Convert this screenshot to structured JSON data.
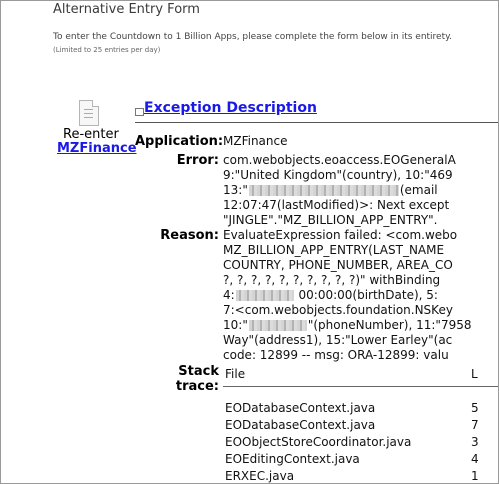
{
  "form": {
    "title": "Alternative Entry Form",
    "instructions": "To enter the Countdown to 1 Billion Apps, please complete the form below in its entirety.",
    "limit_note": "(Limited to 25 entries per day)"
  },
  "reenter": {
    "label": "Re-enter",
    "link": "MZFinance",
    "icon": "document-icon"
  },
  "exception": {
    "title": "Exception Description",
    "application_label": "Application:",
    "application_value": "MZFinance",
    "error_label": "Error:",
    "error_lines": [
      "com.webobjects.eoaccess.EOGeneralA",
      "9:\"United Kingdom\"(country), 10:\"469",
      "13:\"",
      "(email",
      "12:07:47(lastModified)>: Next except",
      "\"JINGLE\".\"MZ_BILLION_APP_ENTRY\"."
    ],
    "reason_label": "Reason:",
    "reason_lines": [
      "EvaluateExpression failed: <com.webo",
      "MZ_BILLION_APP_ENTRY(LAST_NAME",
      "COUNTRY, PHONE_NUMBER, AREA_CO",
      "?, ?, ?, ?, ?, ?, ?, ?, ?, ?)\" withBinding",
      "4:",
      " 00:00:00(birthDate), 5:",
      "7:<com.webobjects.foundation.NSKey",
      "10:\"",
      "\"(phoneNumber), 11:\"7958",
      "Way\"(address1), 15:\"Lower Earley\"(ac",
      "code: 12899 -- msg: ORA-12899: valu"
    ],
    "stack_label_1": "Stack",
    "stack_label_2": "trace:",
    "stack_header_file": "File",
    "stack_header_line": "L",
    "stack_files": [
      "EODatabaseContext.java",
      "EODatabaseContext.java",
      "EOObjectStoreCoordinator.java",
      "EOEditingContext.java",
      "ERXEC.java"
    ],
    "stack_lines": [
      "5",
      "7",
      "3",
      "4",
      "1"
    ]
  },
  "colors": {
    "link": "#1a1ae6",
    "text": "#000000",
    "muted": "#444444"
  }
}
